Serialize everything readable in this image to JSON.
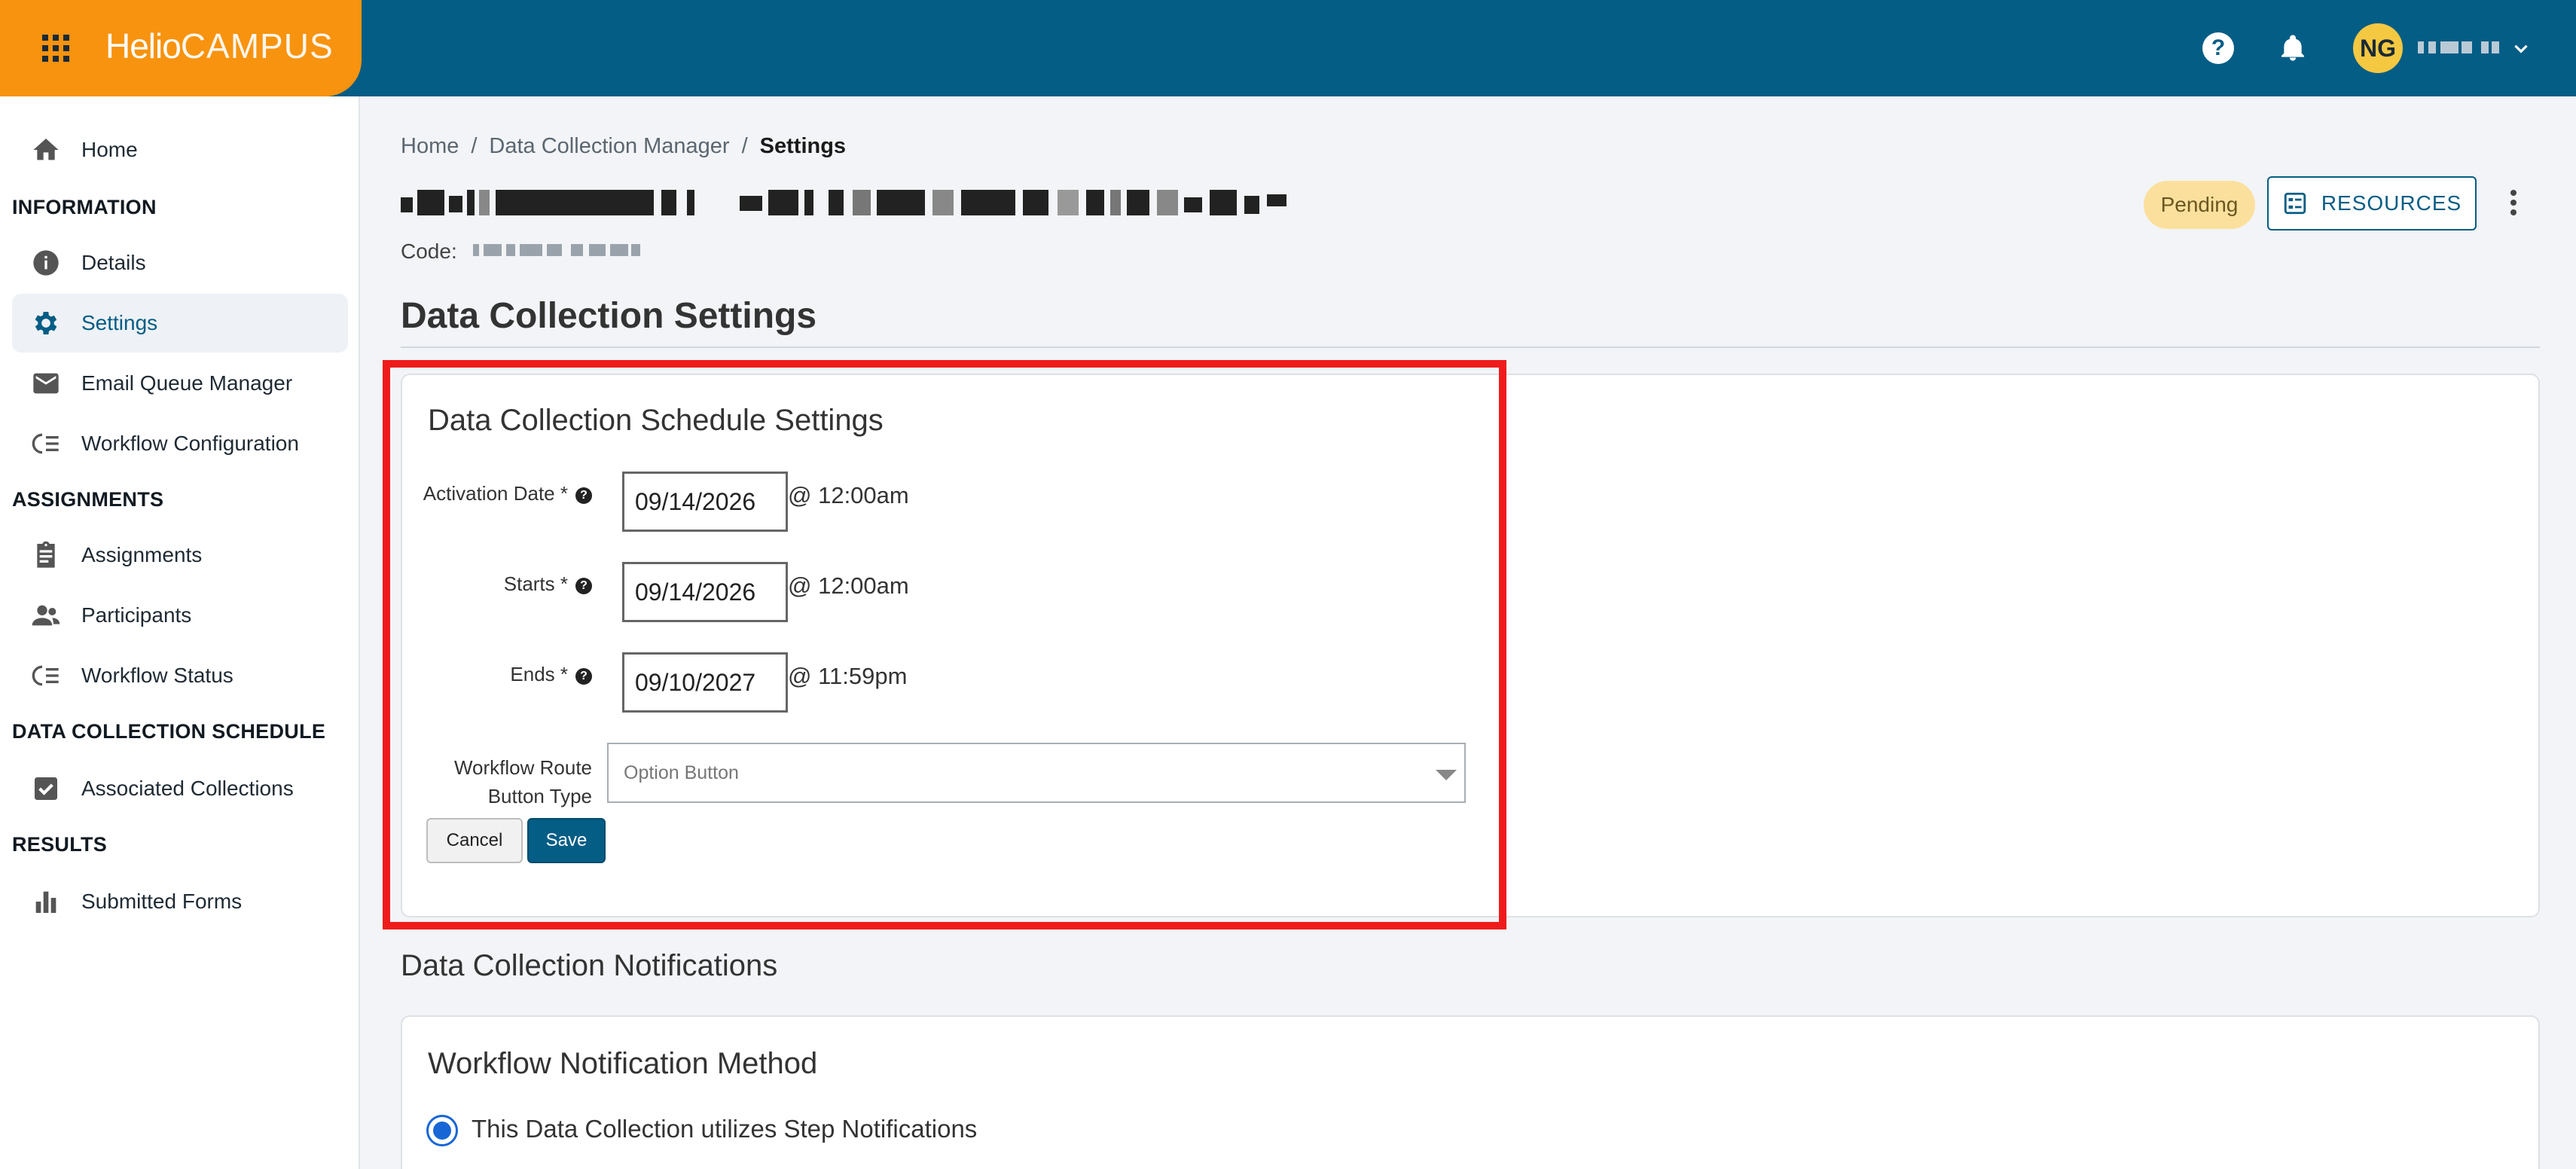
{
  "app": {
    "logo_bold": "Helio",
    "logo_light": "CAMPUS"
  },
  "topbar": {
    "avatar_initials": "NG"
  },
  "sidebar": {
    "items": [
      {
        "label": "Home",
        "icon": "home-icon"
      },
      {
        "label": "Details",
        "icon": "info-icon"
      },
      {
        "label": "Settings",
        "icon": "gear-icon",
        "active": true
      },
      {
        "label": "Email Queue Manager",
        "icon": "email-icon"
      },
      {
        "label": "Workflow Configuration",
        "icon": "workflow-icon"
      },
      {
        "label": "Assignments",
        "icon": "clipboard-icon"
      },
      {
        "label": "Participants",
        "icon": "people-icon"
      },
      {
        "label": "Workflow Status",
        "icon": "workflow-icon"
      },
      {
        "label": "Associated Collections",
        "icon": "checkbox-icon"
      },
      {
        "label": "Submitted Forms",
        "icon": "bar-chart-icon"
      }
    ],
    "sections": [
      "INFORMATION",
      "ASSIGNMENTS",
      "DATA COLLECTION SCHEDULE",
      "RESULTS"
    ]
  },
  "breadcrumb": {
    "home": "Home",
    "parent": "Data Collection Manager",
    "current": "Settings",
    "separator": "/"
  },
  "header": {
    "code_label": "Code:",
    "status_badge": "Pending",
    "resources_label": "RESOURCES"
  },
  "main": {
    "page_title": "Data Collection Settings",
    "schedule": {
      "title": "Data Collection Schedule Settings",
      "activation_label": "Activation Date *",
      "activation_date": "09/14/2026",
      "activation_time": "@ 12:00am",
      "starts_label": "Starts *",
      "starts_date": "09/14/2026",
      "starts_time": "@ 12:00am",
      "ends_label": "Ends *",
      "ends_date": "09/10/2027",
      "ends_time": "@ 11:59pm",
      "route_label_1": "Workflow Route",
      "route_label_2": "Button Type",
      "route_value": "Option Button",
      "cancel_label": "Cancel",
      "save_label": "Save"
    },
    "notifications": {
      "section_title": "Data Collection Notifications",
      "card_title": "Workflow Notification Method",
      "option_label": "This Data Collection utilizes Step Notifications"
    }
  },
  "colors": {
    "topbar": "#045d85",
    "brand": "#f7930f",
    "highlight": "#ef1b1b",
    "badge": "#fbe09d"
  }
}
